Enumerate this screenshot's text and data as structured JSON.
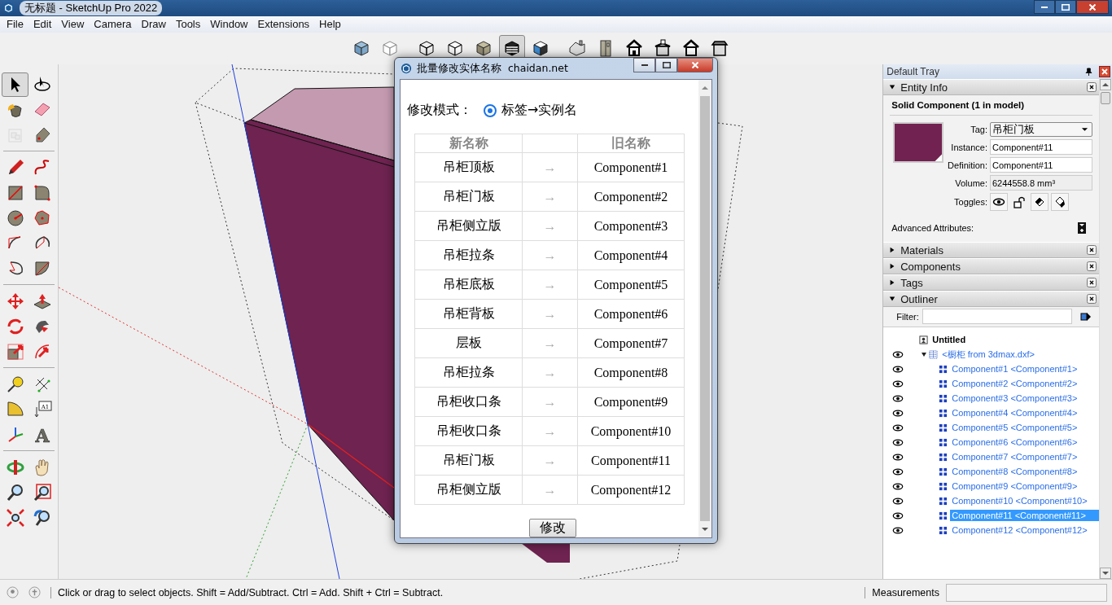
{
  "window": {
    "title": "无标题 - SketchUp Pro 2022"
  },
  "menu": [
    "File",
    "Edit",
    "View",
    "Camera",
    "Draw",
    "Tools",
    "Window",
    "Extensions",
    "Help"
  ],
  "style_toolbar": [
    {
      "selected": false
    },
    {
      "selected": false
    },
    {
      "selected": false
    },
    {
      "selected": false
    },
    {
      "selected": false
    },
    {
      "selected": true
    },
    {
      "selected": false
    }
  ],
  "tools": [
    {
      "selected": true,
      "disabled": false
    },
    {
      "selected": false,
      "disabled": false
    },
    {
      "selected": false,
      "disabled": false
    },
    {
      "selected": false,
      "disabled": false
    },
    {
      "selected": false,
      "disabled": true
    },
    {
      "selected": false,
      "disabled": false
    },
    {
      "selected": false,
      "disabled": false
    },
    {
      "selected": false,
      "disabled": false
    },
    {
      "selected": false,
      "disabled": false
    },
    {
      "selected": false,
      "disabled": false
    },
    {
      "selected": false,
      "disabled": false
    },
    {
      "selected": false,
      "disabled": false
    },
    {
      "selected": false,
      "disabled": false
    },
    {
      "selected": false,
      "disabled": false
    },
    {
      "selected": false,
      "disabled": false
    },
    {
      "selected": false,
      "disabled": false
    },
    {
      "selected": false,
      "disabled": false
    },
    {
      "selected": false,
      "disabled": false
    },
    {
      "selected": false,
      "disabled": false
    },
    {
      "selected": false,
      "disabled": false
    },
    {
      "selected": false,
      "disabled": false
    },
    {
      "selected": false,
      "disabled": false
    },
    {
      "selected": false,
      "disabled": false
    },
    {
      "selected": false,
      "disabled": false
    },
    {
      "selected": false,
      "disabled": false
    },
    {
      "selected": false,
      "disabled": false,
      "glyph": "A1"
    },
    {
      "selected": false,
      "disabled": false
    },
    {
      "selected": false,
      "disabled": false,
      "glyph": "A"
    },
    {
      "selected": false,
      "disabled": false
    },
    {
      "selected": false,
      "disabled": false
    },
    {
      "selected": false,
      "disabled": false
    },
    {
      "selected": false,
      "disabled": false
    },
    {
      "selected": false,
      "disabled": false
    },
    {
      "selected": false,
      "disabled": false
    }
  ],
  "dialog": {
    "title": "批量修改实体名称  chaidan.net",
    "mode_label": "修改模式：",
    "mode_option": {
      "label": "标签→实例名",
      "selected": true
    },
    "columns": {
      "new": "新名称",
      "old": "旧名称"
    },
    "rows": [
      {
        "new": "吊柜顶板",
        "arrow": "→",
        "old": "Component#1"
      },
      {
        "new": "吊柜门板",
        "arrow": "→",
        "old": "Component#2"
      },
      {
        "new": "吊柜侧立版",
        "arrow": "→",
        "old": "Component#3"
      },
      {
        "new": "吊柜拉条",
        "arrow": "→",
        "old": "Component#4"
      },
      {
        "new": "吊柜底板",
        "arrow": "→",
        "old": "Component#5"
      },
      {
        "new": "吊柜背板",
        "arrow": "→",
        "old": "Component#6"
      },
      {
        "new": "层板",
        "arrow": "→",
        "old": "Component#7"
      },
      {
        "new": "吊柜拉条",
        "arrow": "→",
        "old": "Component#8"
      },
      {
        "new": "吊柜收口条",
        "arrow": "→",
        "old": "Component#9"
      },
      {
        "new": "吊柜收口条",
        "arrow": "→",
        "old": "Component#10"
      },
      {
        "new": "吊柜门板",
        "arrow": "→",
        "old": "Component#11"
      },
      {
        "new": "吊柜侧立版",
        "arrow": "→",
        "old": "Component#12"
      }
    ],
    "button": "修改"
  },
  "tray": {
    "title": "Default Tray",
    "panels": [
      {
        "kind": "entity_info",
        "title": "Entity Info",
        "expanded": true,
        "heading": "Solid Component (1 in model)",
        "fields": [
          {
            "kind": "select",
            "label": "Tag:",
            "value": "吊柜门板"
          },
          {
            "kind": "input",
            "label": "Instance:",
            "value": "Component#11"
          },
          {
            "kind": "input",
            "label": "Definition:",
            "value": "Component#11"
          },
          {
            "kind": "readonly",
            "label": "Volume:",
            "value": "6244558.8 mm³"
          }
        ],
        "toggles_label": "Toggles:",
        "advanced_label": "Advanced Attributes:"
      },
      {
        "title": "Materials",
        "expanded": false
      },
      {
        "title": "Components",
        "expanded": false
      },
      {
        "title": "Tags",
        "expanded": false
      },
      {
        "kind": "outliner",
        "title": "Outliner",
        "expanded": true,
        "filter_label": "Filter:",
        "tree": [
          {
            "kind": "model",
            "label": "Untitled",
            "children": [
              {
                "kind": "group",
                "label": "<橱柜 from 3dmax.dxf>",
                "visible": true,
                "expanded": true,
                "children": [
                  {
                    "kind": "component",
                    "label": "Component#1 <Component#1>",
                    "visible": true,
                    "selected": false
                  },
                  {
                    "kind": "component",
                    "label": "Component#2 <Component#2>",
                    "visible": true,
                    "selected": false
                  },
                  {
                    "kind": "component",
                    "label": "Component#3 <Component#3>",
                    "visible": true,
                    "selected": false
                  },
                  {
                    "kind": "component",
                    "label": "Component#4 <Component#4>",
                    "visible": true,
                    "selected": false
                  },
                  {
                    "kind": "component",
                    "label": "Component#5 <Component#5>",
                    "visible": true,
                    "selected": false
                  },
                  {
                    "kind": "component",
                    "label": "Component#6 <Component#6>",
                    "visible": true,
                    "selected": false
                  },
                  {
                    "kind": "component",
                    "label": "Component#7 <Component#7>",
                    "visible": true,
                    "selected": false
                  },
                  {
                    "kind": "component",
                    "label": "Component#8 <Component#8>",
                    "visible": true,
                    "selected": false
                  },
                  {
                    "kind": "component",
                    "label": "Component#9 <Component#9>",
                    "visible": true,
                    "selected": false
                  },
                  {
                    "kind": "component",
                    "label": "Component#10 <Component#10>",
                    "visible": true,
                    "selected": false
                  },
                  {
                    "kind": "component",
                    "label": "Component#11 <Component#11>",
                    "visible": true,
                    "selected": true
                  },
                  {
                    "kind": "component",
                    "label": "Component#12 <Component#12>",
                    "visible": true,
                    "selected": false
                  }
                ]
              }
            ]
          }
        ]
      }
    ]
  },
  "status_bar": {
    "hint": "Click or drag to select objects. Shift = Add/Subtract. Ctrl = Add. Shift + Ctrl = Subtract.",
    "measurements_label": "Measurements"
  }
}
